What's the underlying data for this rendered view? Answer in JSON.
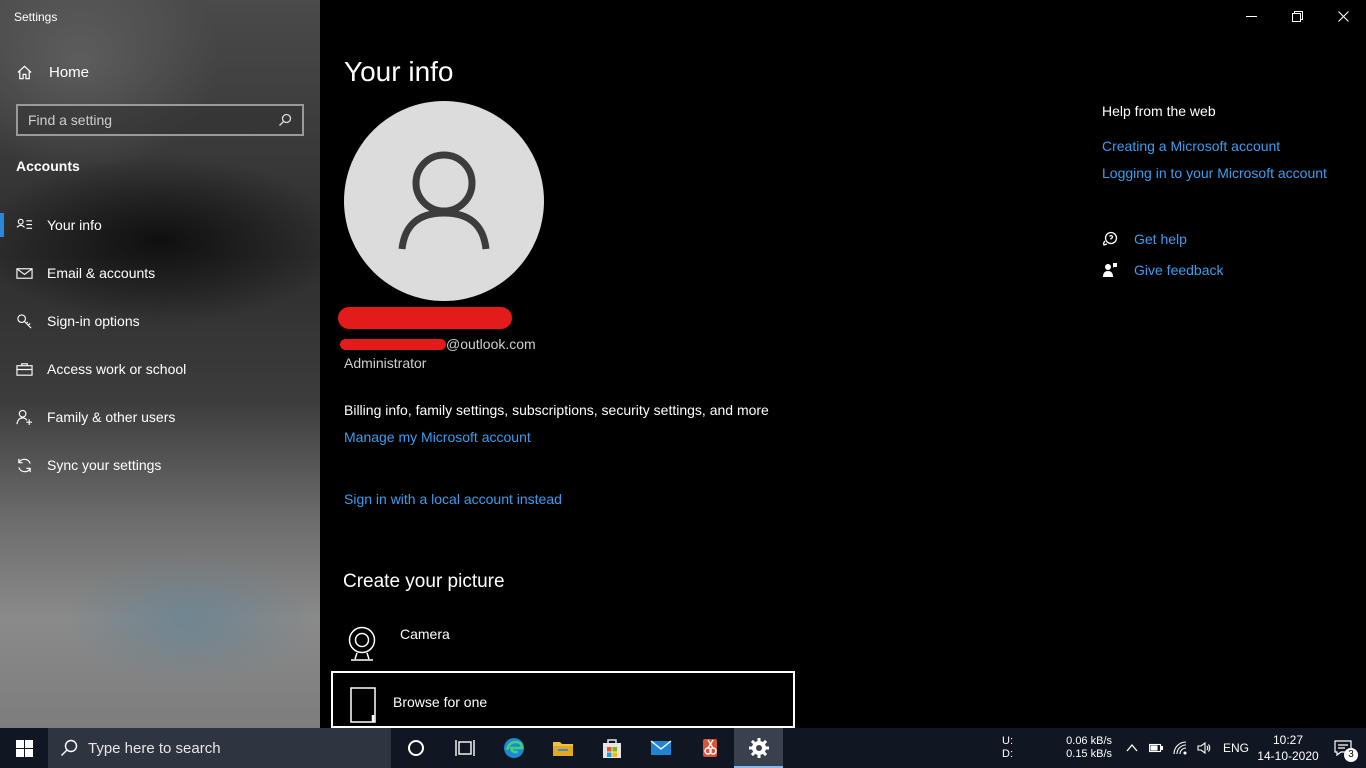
{
  "window": {
    "title": "Settings"
  },
  "sidebar": {
    "home_label": "Home",
    "search_placeholder": "Find a setting",
    "section_heading": "Accounts",
    "items": [
      {
        "label": "Your info",
        "icon": "your-info-icon",
        "active": true
      },
      {
        "label": "Email & accounts",
        "icon": "mail-icon"
      },
      {
        "label": "Sign-in options",
        "icon": "key-icon"
      },
      {
        "label": "Access work or school",
        "icon": "briefcase-icon"
      },
      {
        "label": "Family & other users",
        "icon": "person-add-icon"
      },
      {
        "label": "Sync your settings",
        "icon": "sync-icon"
      }
    ]
  },
  "main": {
    "title": "Your info",
    "email_suffix": "@outlook.com",
    "role": "Administrator",
    "billing_text": "Billing info, family settings, subscriptions, security settings, and more",
    "manage_link": "Manage my Microsoft account",
    "local_account_link": "Sign in with a local account instead",
    "create_picture_heading": "Create your picture",
    "camera_label": "Camera",
    "browse_label": "Browse for one"
  },
  "help": {
    "heading": "Help from the web",
    "links": [
      "Creating a Microsoft account",
      "Logging in to your Microsoft account"
    ],
    "get_help": "Get help",
    "give_feedback": "Give feedback"
  },
  "taskbar": {
    "search_placeholder": "Type here to search",
    "net_up_label": "U:",
    "net_down_label": "D:",
    "net_up_speed": "0.06 kB/s",
    "net_down_speed": "0.15 kB/s",
    "language": "ENG",
    "time": "10:27",
    "date": "14-10-2020",
    "notification_count": "3"
  },
  "colors": {
    "accent": "#2b88d8",
    "link": "#3a9df0",
    "redaction": "#e31b1b",
    "taskbar": "#101622"
  }
}
